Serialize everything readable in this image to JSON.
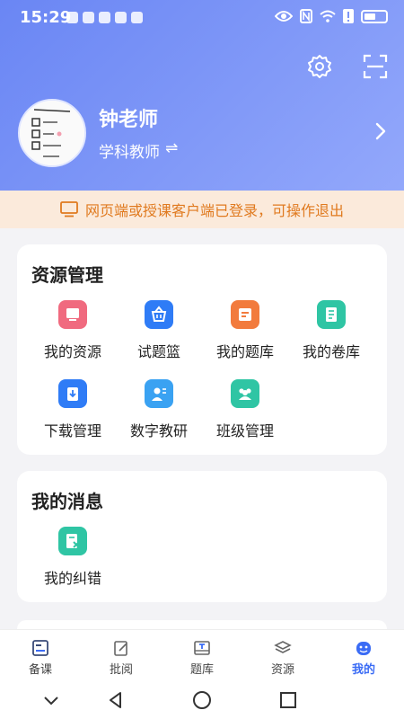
{
  "status_bar": {
    "time": "15:29"
  },
  "user": {
    "name": "钟老师",
    "role": "学科教师"
  },
  "notice": {
    "text": "网页端或授课客户端已登录，可操作退出",
    "color": "#e07a1f"
  },
  "resources": {
    "title": "资源管理",
    "items": [
      {
        "label": "我的资源",
        "icon": "my-resources-icon",
        "color": "#f06a7f"
      },
      {
        "label": "试题篮",
        "icon": "basket-icon",
        "color": "#2f7cf6"
      },
      {
        "label": "我的题库",
        "icon": "question-bank-icon",
        "color": "#f27b3d"
      },
      {
        "label": "我的卷库",
        "icon": "paper-bank-icon",
        "color": "#2fc5a4"
      },
      {
        "label": "下载管理",
        "icon": "download-icon",
        "color": "#2f7cf6"
      },
      {
        "label": "数字教研",
        "icon": "teaching-research-icon",
        "color": "#3aa2f2"
      },
      {
        "label": "班级管理",
        "icon": "class-management-icon",
        "color": "#2fc5a4"
      }
    ]
  },
  "messages": {
    "title": "我的消息",
    "items": [
      {
        "label": "我的纠错",
        "icon": "corrections-icon",
        "color": "#2fc5a4"
      }
    ]
  },
  "tabbar": {
    "active_color": "#3b6cf5",
    "tabs": [
      {
        "label": "备课",
        "icon": "lesson-prep-icon"
      },
      {
        "label": "批阅",
        "icon": "review-icon"
      },
      {
        "label": "题库",
        "icon": "question-library-icon"
      },
      {
        "label": "资源",
        "icon": "resources-icon"
      },
      {
        "label": "我的",
        "icon": "profile-icon",
        "active": true
      }
    ]
  }
}
